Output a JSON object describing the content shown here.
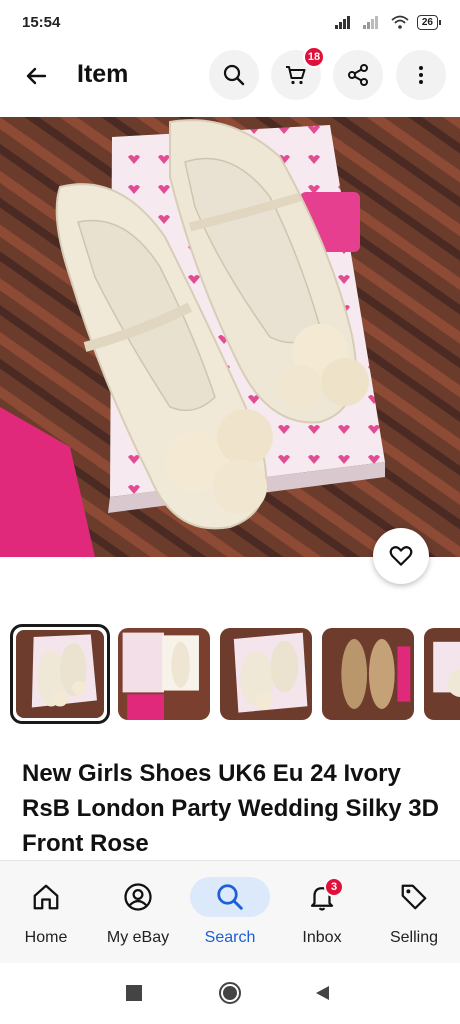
{
  "status_bar": {
    "time": "15:54",
    "battery": "26"
  },
  "app_bar": {
    "title": "Item",
    "cart_count": "18"
  },
  "item": {
    "title": "New Girls Shoes UK6 Eu 24 Ivory RsB London Party Wedding Silky 3D Front Rose"
  },
  "thumbnails": [
    {
      "name": "thumbnail-1",
      "selected": true
    },
    {
      "name": "thumbnail-2",
      "selected": false
    },
    {
      "name": "thumbnail-3",
      "selected": false
    },
    {
      "name": "thumbnail-4",
      "selected": false
    },
    {
      "name": "thumbnail-5",
      "selected": false
    }
  ],
  "bottom_nav": {
    "home": "Home",
    "my_ebay": "My eBay",
    "search": "Search",
    "inbox": "Inbox",
    "inbox_badge": "3",
    "selling": "Selling"
  },
  "colors": {
    "accent": "#1c5fd6",
    "active_pill": "#dce9fb",
    "badge": "#e0103a"
  },
  "icons": [
    "back-arrow-icon",
    "search-icon",
    "cart-icon",
    "share-icon",
    "more-vertical-icon",
    "heart-icon",
    "home-icon",
    "account-icon",
    "search-icon",
    "bell-icon",
    "tag-icon"
  ]
}
